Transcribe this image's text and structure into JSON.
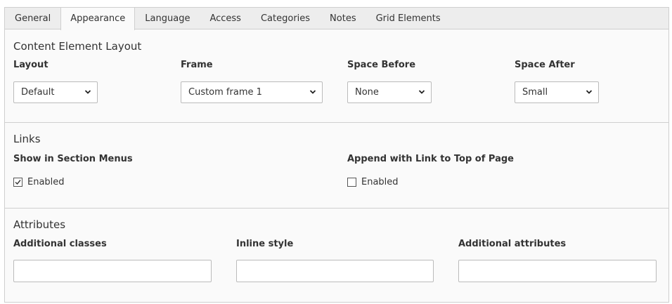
{
  "tabs": [
    {
      "label": "General"
    },
    {
      "label": "Appearance"
    },
    {
      "label": "Language"
    },
    {
      "label": "Access"
    },
    {
      "label": "Categories"
    },
    {
      "label": "Notes"
    },
    {
      "label": "Grid Elements"
    }
  ],
  "active_tab": "Appearance",
  "layout_section": {
    "title": "Content Element Layout",
    "fields": {
      "layout": {
        "label": "Layout",
        "value": "Default"
      },
      "frame": {
        "label": "Frame",
        "value": "Custom frame 1"
      },
      "space_before": {
        "label": "Space Before",
        "value": "None"
      },
      "space_after": {
        "label": "Space After",
        "value": "Small"
      }
    }
  },
  "links_section": {
    "title": "Links",
    "show_in_menus": {
      "label": "Show in Section Menus",
      "option": "Enabled",
      "checked": true
    },
    "link_to_top": {
      "label": "Append with Link to Top of Page",
      "option": "Enabled",
      "checked": false
    }
  },
  "attributes_section": {
    "title": "Attributes",
    "additional_classes": {
      "label": "Additional classes",
      "value": ""
    },
    "inline_style": {
      "label": "Inline style",
      "value": ""
    },
    "additional_attributes": {
      "label": "Additional attributes",
      "value": ""
    }
  }
}
